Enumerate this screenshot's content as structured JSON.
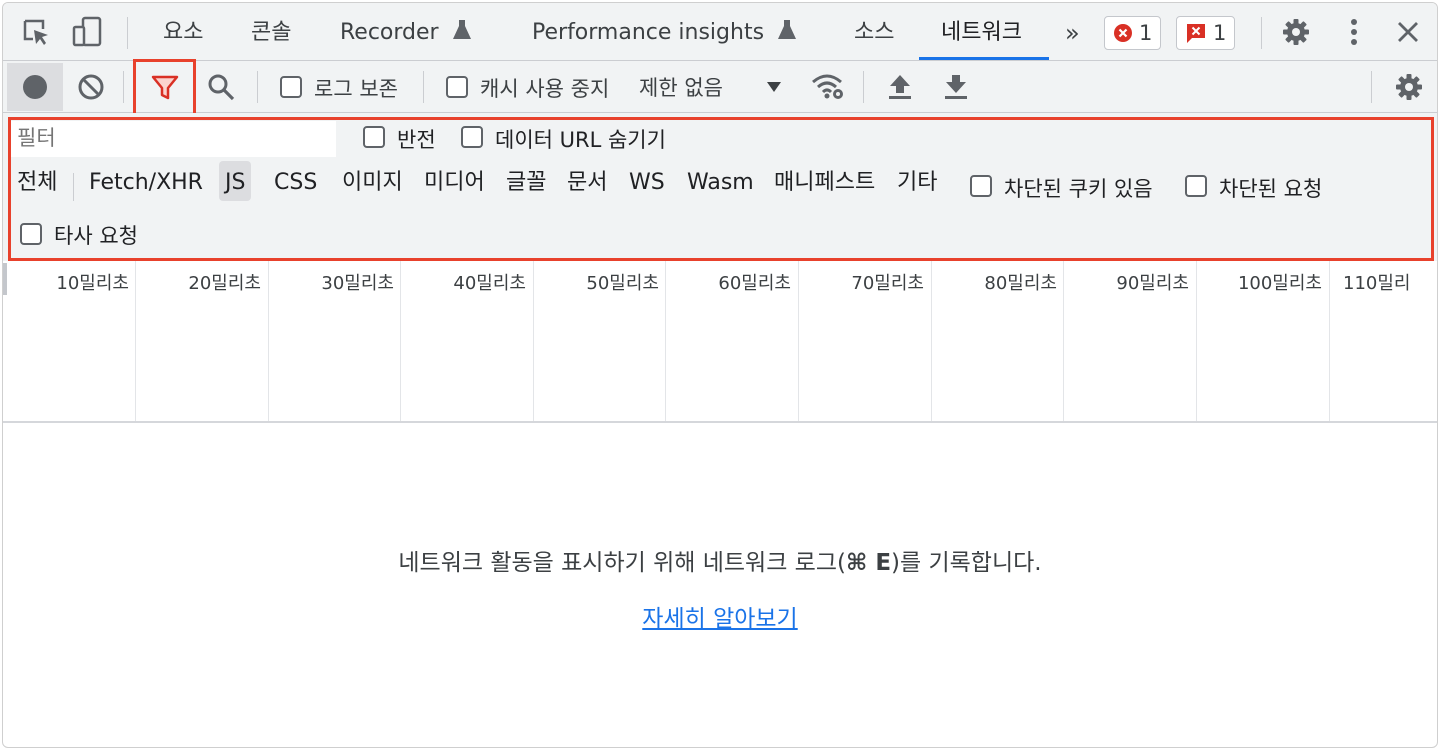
{
  "tabbar": {
    "tabs": [
      {
        "label": "요소"
      },
      {
        "label": "콘솔"
      },
      {
        "label": "Recorder"
      },
      {
        "label": "Performance insights"
      },
      {
        "label": "소스"
      },
      {
        "label": "네트워크"
      }
    ],
    "more_label": "»",
    "error_count": "1",
    "issue_count": "1"
  },
  "toolbar": {
    "preserve_log_label": "로그 보존",
    "disable_cache_label": "캐시 사용 중지",
    "throttling_value": "제한 없음"
  },
  "filter": {
    "placeholder": "필터",
    "invert_label": "반전",
    "hide_data_urls_label": "데이터 URL 숨기기",
    "types": [
      "전체",
      "Fetch/XHR",
      "JS",
      "CSS",
      "이미지",
      "미디어",
      "글꼴",
      "문서",
      "WS",
      "Wasm",
      "매니페스트",
      "기타"
    ],
    "selected_type": "JS",
    "blocked_cookies_label": "차단된 쿠키 있음",
    "blocked_requests_label": "차단된 요청",
    "third_party_label": "타사 요청"
  },
  "timeline": {
    "ticks": [
      "10밀리초",
      "20밀리초",
      "30밀리초",
      "40밀리초",
      "50밀리초",
      "60밀리초",
      "70밀리초",
      "80밀리초",
      "90밀리초",
      "100밀리초",
      "110밀리"
    ]
  },
  "empty_state": {
    "message_prefix": "네트워크 활동을 표시하기 위해 네트워크 로그(",
    "shortcut": "⌘ E",
    "message_suffix": ")를 기록합니다.",
    "learn_more": "자세히 알아보기"
  },
  "colors": {
    "accent": "#1a73e8",
    "highlight": "#e8412c",
    "error_red": "#d93025",
    "toolbar_bg": "#f1f3f4"
  }
}
